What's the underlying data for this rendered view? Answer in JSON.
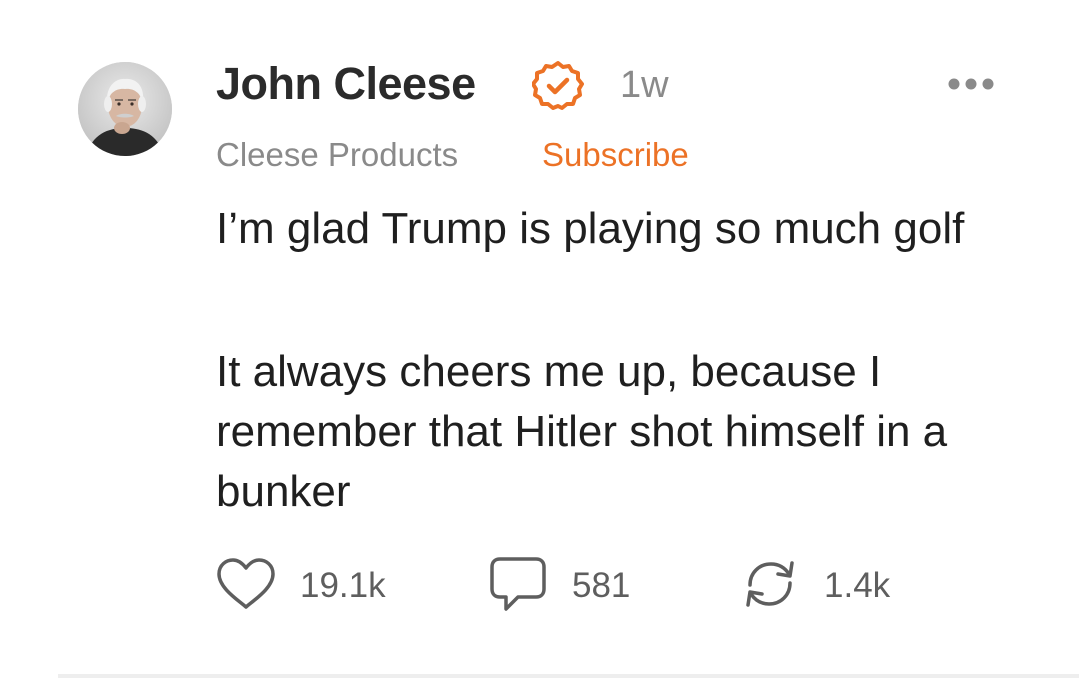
{
  "author": {
    "name": "John Cleese",
    "verified_icon": "verified-check-icon",
    "time_ago": "1w",
    "publication": "Cleese Products",
    "subscribe_label": "Subscribe"
  },
  "post": {
    "paragraph1": "I’m glad Trump is playing so much golf",
    "paragraph2": "It always cheers me up, because I remember that Hitler shot himself in a bunker"
  },
  "actions": {
    "likes": "19.1k",
    "comments": "581",
    "restacks": "1.4k"
  },
  "colors": {
    "accent": "#ec7226",
    "muted_text": "#8a8a8a",
    "body_text": "#1f1f1f"
  }
}
